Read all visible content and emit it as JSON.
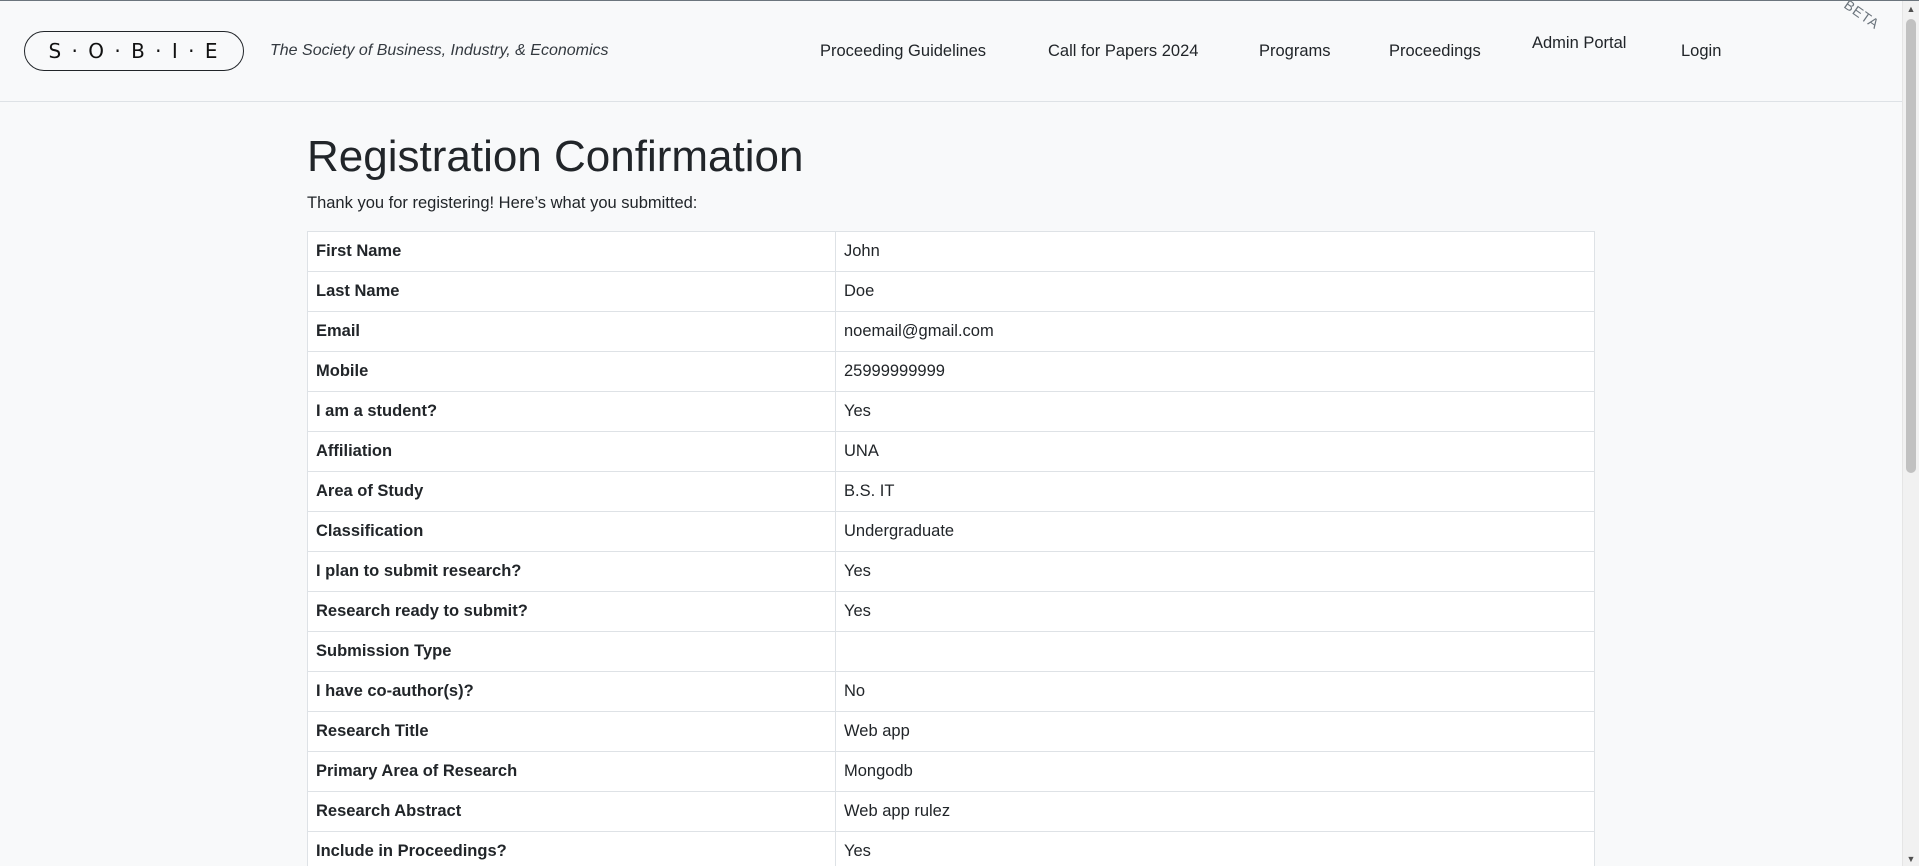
{
  "header": {
    "logo": "S · O · B · I · E",
    "tagline": "The Society of Business, Industry, & Economics",
    "nav": [
      {
        "label": "Proceeding Guidelines"
      },
      {
        "label": "Call for Papers 2024"
      },
      {
        "label": "Programs"
      },
      {
        "label": "Proceedings"
      },
      {
        "label": "Admin Portal"
      },
      {
        "label": "Login"
      }
    ],
    "beta_label": "BETA"
  },
  "main": {
    "title": "Registration Confirmation",
    "subtitle": "Thank you for registering! Here’s what you submitted:",
    "rows": [
      {
        "label": "First Name",
        "value": "John"
      },
      {
        "label": "Last Name",
        "value": "Doe"
      },
      {
        "label": "Email",
        "value": "noemail@gmail.com"
      },
      {
        "label": "Mobile",
        "value": "25999999999"
      },
      {
        "label": "I am a student?",
        "value": "Yes"
      },
      {
        "label": "Affiliation",
        "value": "UNA"
      },
      {
        "label": "Area of Study",
        "value": "B.S. IT"
      },
      {
        "label": "Classification",
        "value": "Undergraduate"
      },
      {
        "label": "I plan to submit research?",
        "value": "Yes"
      },
      {
        "label": "Research ready to submit?",
        "value": "Yes"
      },
      {
        "label": "Submission Type",
        "value": ""
      },
      {
        "label": "I have co-author(s)?",
        "value": "No"
      },
      {
        "label": "Research Title",
        "value": "Web app"
      },
      {
        "label": "Primary Area of Research",
        "value": "Mongodb"
      },
      {
        "label": "Research Abstract",
        "value": "Web app rulez"
      },
      {
        "label": "Include in Proceedings?",
        "value": "Yes"
      }
    ]
  },
  "scrollbar": {
    "up_icon": "chevron-up-icon",
    "down_icon": "chevron-down-icon"
  }
}
